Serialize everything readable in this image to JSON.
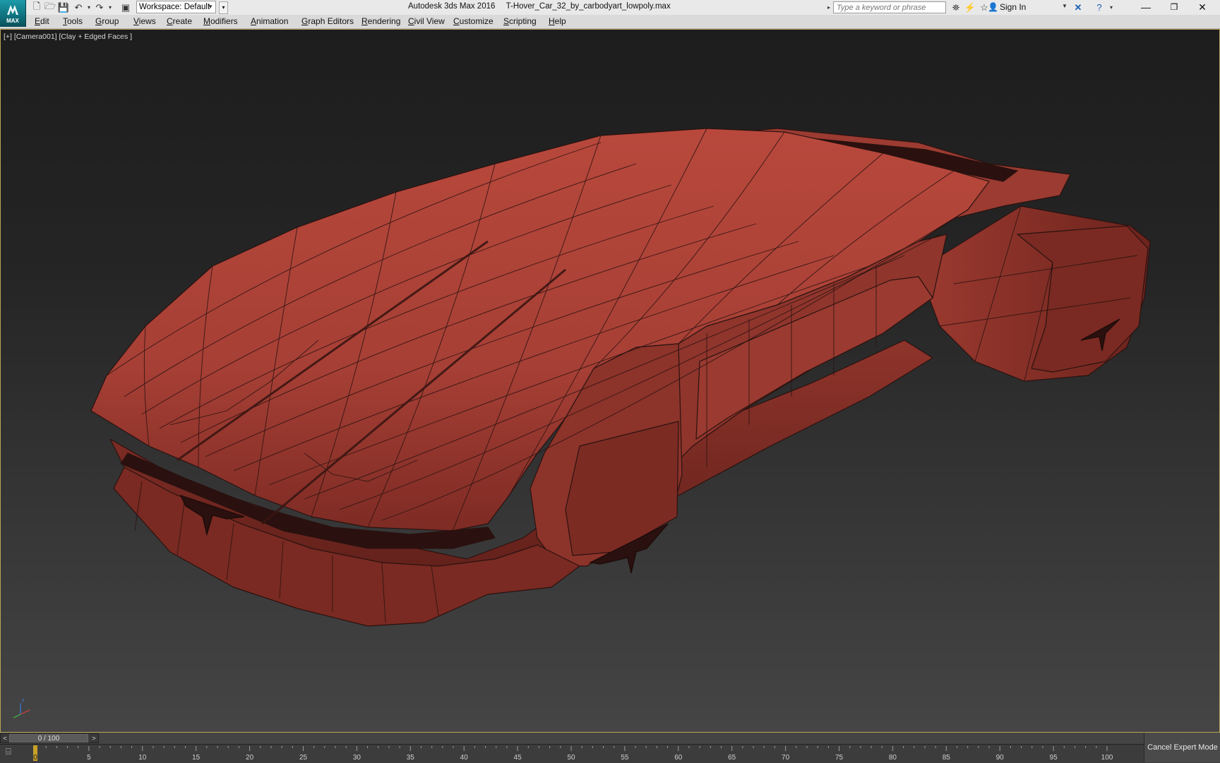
{
  "titlebar": {
    "logo_label": "MAX",
    "workspace_label": "Workspace: Default",
    "app_name": "Autodesk 3ds Max 2016",
    "file_name": "T-Hover_Car_32_by_carbodyart_lowpoly.max",
    "search_placeholder": "Type a keyword or phrase",
    "sign_in_label": "Sign In"
  },
  "menu": [
    "Edit",
    "Tools",
    "Group",
    "Views",
    "Create",
    "Modifiers",
    "Animation",
    "Graph Editors",
    "Rendering",
    "Civil View",
    "Customize",
    "Scripting",
    "Help"
  ],
  "viewport": {
    "label": "[+] [Camera001] [Clay + Edged Faces ]",
    "model_color": "#b5473b",
    "edge_color": "#2a1210"
  },
  "timeline": {
    "frame_label": "0 / 100",
    "ticks": [
      "0",
      "5",
      "10",
      "15",
      "20",
      "25",
      "30",
      "35",
      "40",
      "45",
      "50",
      "55",
      "60",
      "65",
      "70",
      "75",
      "80",
      "85",
      "90",
      "95",
      "100"
    ],
    "cancel_label": "Cancel Expert Mode"
  }
}
